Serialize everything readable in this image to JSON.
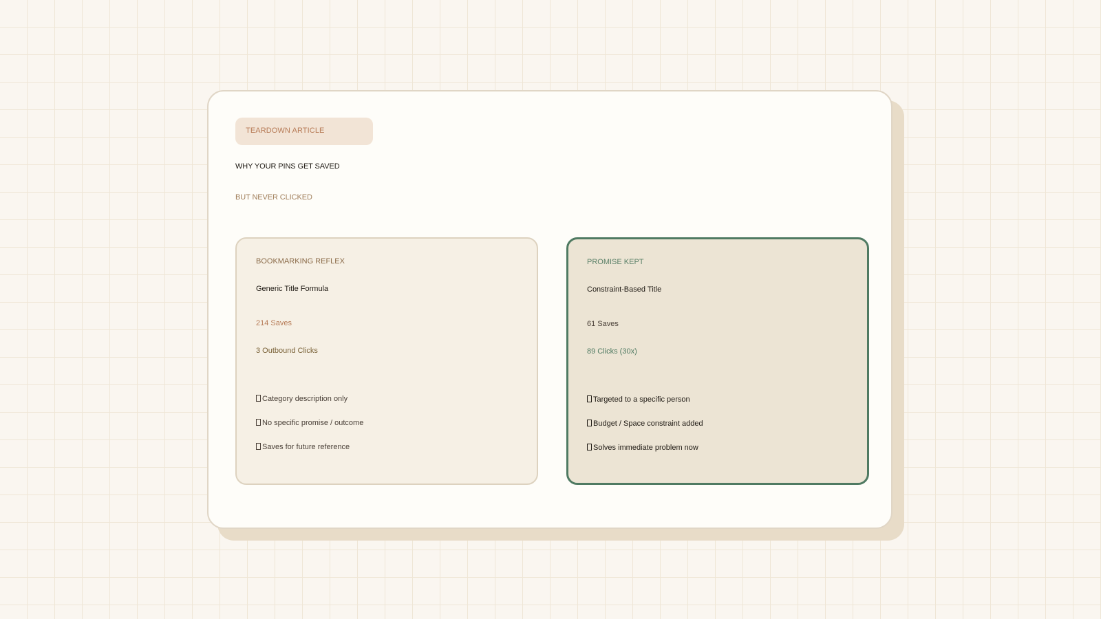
{
  "colors": {
    "background": "#faf6f0",
    "grid_line": "#efe6d6",
    "card": "#fefdf9",
    "shadow": "#e8dcc8",
    "badge_bg": "#f2e4d6",
    "accent_orange": "#b67a55",
    "accent_green": "#4f7a62"
  },
  "header": {
    "badge": "TEARDOWN ARTICLE",
    "title_line1": "WHY YOUR PINS GET SAVED",
    "title_line2": "BUT NEVER CLICKED"
  },
  "left_panel": {
    "label": "BOOKMARKING REFLEX",
    "heading": "Generic Title Formula",
    "stat_primary": "214 Saves",
    "stat_secondary": "3 Outbound Clicks",
    "items": [
      "Category description only",
      "No specific promise / outcome",
      "Saves for future reference"
    ]
  },
  "right_panel": {
    "label": "PROMISE KEPT",
    "heading": "Constraint-Based Title",
    "stat_primary": "61 Saves",
    "stat_secondary": "89 Clicks (30x)",
    "items": [
      "Targeted to a specific person",
      "Budget / Space constraint added",
      "Solves immediate problem now"
    ]
  }
}
